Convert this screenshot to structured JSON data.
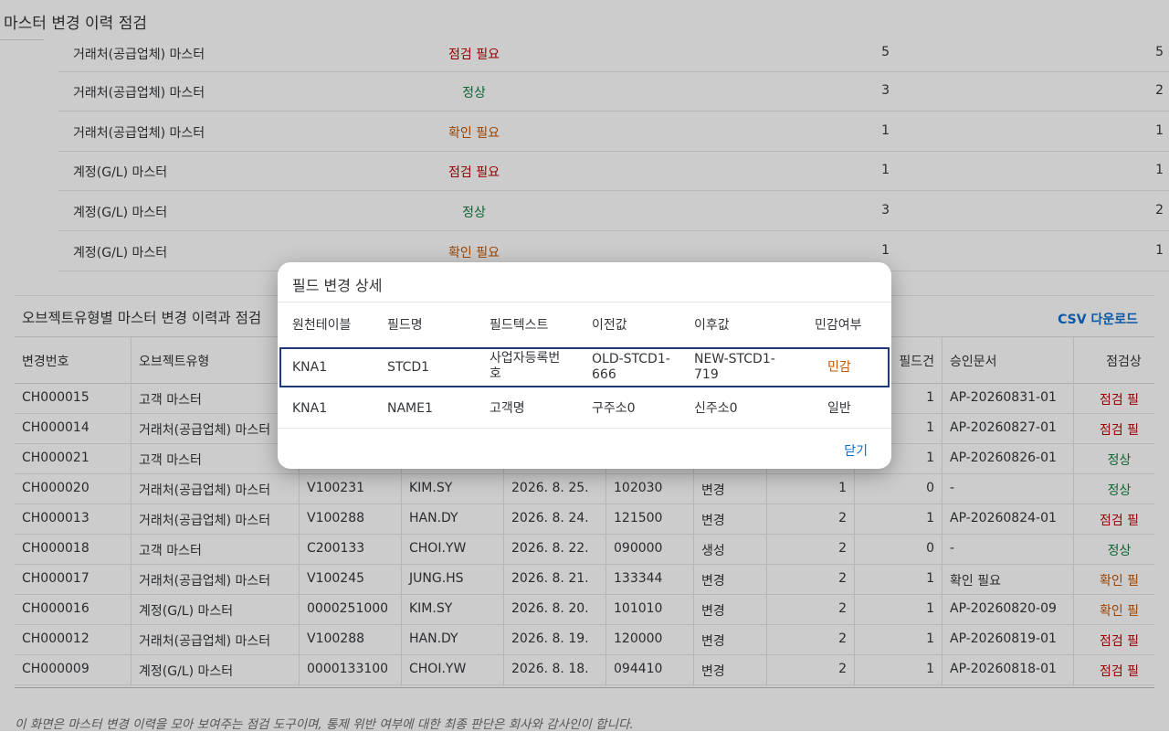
{
  "page": {
    "title": "마스터 변경 이력 점검"
  },
  "summary": {
    "rows": [
      {
        "object": "거래처(공급업체) 마스터",
        "status": "점검 필요",
        "status_color": "red",
        "n1": "5",
        "n2": "5"
      },
      {
        "object": "거래처(공급업체) 마스터",
        "status": "정상",
        "status_color": "green",
        "n1": "3",
        "n2": "2"
      },
      {
        "object": "거래처(공급업체) 마스터",
        "status": "확인 필요",
        "status_color": "orange",
        "n1": "1",
        "n2": "1"
      },
      {
        "object": "계정(G/L) 마스터",
        "status": "점검 필요",
        "status_color": "red",
        "n1": "1",
        "n2": "1"
      },
      {
        "object": "계정(G/L) 마스터",
        "status": "정상",
        "status_color": "green",
        "n1": "3",
        "n2": "2"
      },
      {
        "object": "계정(G/L) 마스터",
        "status": "확인 필요",
        "status_color": "orange",
        "n1": "1",
        "n2": "1"
      }
    ]
  },
  "history": {
    "title": "오브젝트유형별 마스터 변경 이력과 점검",
    "csv_label": "CSV 다운로드",
    "columns": [
      "변경번호",
      "오브젝트유형",
      "",
      "",
      "",
      "",
      "",
      "",
      "필드건",
      "승인문서",
      "점검상"
    ],
    "rows": [
      {
        "no": "CH000015",
        "object": "고객 마스터",
        "key": "",
        "user": "",
        "date": "",
        "time": "",
        "type": "",
        "cnt": "",
        "fld": "1",
        "doc": "AP-20260831-01",
        "status": "점검 필",
        "status_color": "red"
      },
      {
        "no": "CH000014",
        "object": "거래처(공급업체) 마스터",
        "key": "",
        "user": "",
        "date": "",
        "time": "",
        "type": "",
        "cnt": "",
        "fld": "1",
        "doc": "AP-20260827-01",
        "status": "점검 필",
        "status_color": "red"
      },
      {
        "no": "CH000021",
        "object": "고객 마스터",
        "key": "",
        "user": "",
        "date": "",
        "time": "",
        "type": "",
        "cnt": "",
        "fld": "1",
        "doc": "AP-20260826-01",
        "status": "정상",
        "status_color": "green"
      },
      {
        "no": "CH000020",
        "object": "거래처(공급업체) 마스터",
        "key": "V100231",
        "user": "KIM.SY",
        "date": "2026. 8. 25.",
        "time": "102030",
        "type": "변경",
        "cnt": "1",
        "fld": "0",
        "doc": "-",
        "status": "정상",
        "status_color": "green"
      },
      {
        "no": "CH000013",
        "object": "거래처(공급업체) 마스터",
        "key": "V100288",
        "user": "HAN.DY",
        "date": "2026. 8. 24.",
        "time": "121500",
        "type": "변경",
        "cnt": "2",
        "fld": "1",
        "doc": "AP-20260824-01",
        "status": "점검 필",
        "status_color": "red"
      },
      {
        "no": "CH000018",
        "object": "고객 마스터",
        "key": "C200133",
        "user": "CHOI.YW",
        "date": "2026. 8. 22.",
        "time": "090000",
        "type": "생성",
        "cnt": "2",
        "fld": "0",
        "doc": "-",
        "status": "정상",
        "status_color": "green"
      },
      {
        "no": "CH000017",
        "object": "거래처(공급업체) 마스터",
        "key": "V100245",
        "user": "JUNG.HS",
        "date": "2026. 8. 21.",
        "time": "133344",
        "type": "변경",
        "cnt": "2",
        "fld": "1",
        "doc": "확인 필요",
        "status": "확인 필",
        "status_color": "orange"
      },
      {
        "no": "CH000016",
        "object": "계정(G/L) 마스터",
        "key": "0000251000",
        "user": "KIM.SY",
        "date": "2026. 8. 20.",
        "time": "101010",
        "type": "변경",
        "cnt": "2",
        "fld": "1",
        "doc": "AP-20260820-09",
        "status": "확인 필",
        "status_color": "orange"
      },
      {
        "no": "CH000012",
        "object": "거래처(공급업체) 마스터",
        "key": "V100288",
        "user": "HAN.DY",
        "date": "2026. 8. 19.",
        "time": "120000",
        "type": "변경",
        "cnt": "2",
        "fld": "1",
        "doc": "AP-20260819-01",
        "status": "점검 필",
        "status_color": "red"
      },
      {
        "no": "CH000009",
        "object": "계정(G/L) 마스터",
        "key": "0000133100",
        "user": "CHOI.YW",
        "date": "2026. 8. 18.",
        "time": "094410",
        "type": "변경",
        "cnt": "2",
        "fld": "1",
        "doc": "AP-20260818-01",
        "status": "점검 필",
        "status_color": "red"
      }
    ]
  },
  "footnote": "이 화면은 마스터 변경 이력을 모아 보여주는 점검 도구이며, 통제 위반 여부에 대한 최종 판단은 회사와 감사인이 합니다.",
  "dialog": {
    "title": "필드 변경 상세",
    "columns": [
      "원천테이블",
      "필드명",
      "필드텍스트",
      "이전값",
      "이후값",
      "민감여부"
    ],
    "rows": [
      {
        "table": "KNA1",
        "field": "STCD1",
        "text1": "사업자등록번",
        "text2": "호",
        "old1": "OLD-STCD1-",
        "old2": "666",
        "new1": "NEW-STCD1-",
        "new2": "719",
        "sensitive": "민감",
        "sensitive_color": "orange"
      },
      {
        "table": "KNA1",
        "field": "NAME1",
        "text1": "고객명",
        "text2": "",
        "old1": "구주소0",
        "old2": "",
        "new1": "신주소0",
        "new2": "",
        "sensitive": "일반",
        "sensitive_color": "normal"
      }
    ],
    "close_label": "닫기"
  },
  "colors": {
    "red": "#bb0000",
    "green": "#107e3e",
    "orange": "#c35500",
    "link": "#0a6ed1",
    "selection": "#1f3a7a"
  }
}
